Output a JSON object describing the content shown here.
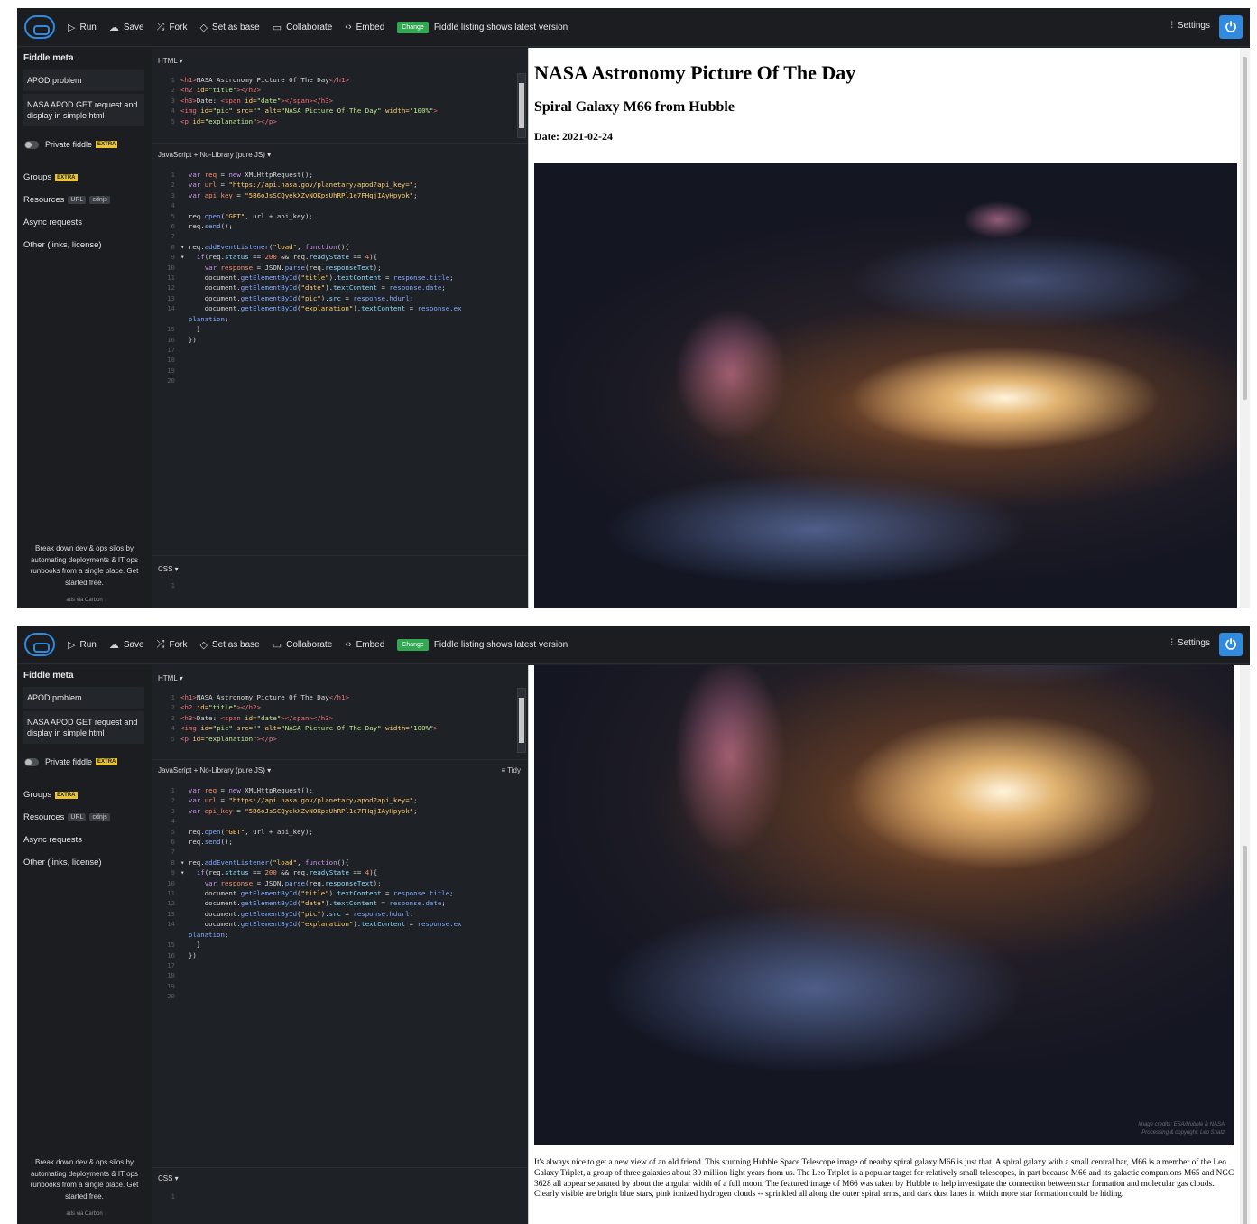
{
  "toolbar": {
    "run": "Run",
    "save": "Save",
    "fork": "Fork",
    "set_as_base": "Set as base",
    "collaborate": "Collaborate",
    "embed": "Embed",
    "change_badge": "Change",
    "listing_text": "Fiddle listing shows latest version",
    "settings": "Settings",
    "accent_color": "#2f8ae0",
    "badge_color": "#33a852"
  },
  "sidebar": {
    "title": "Fiddle meta",
    "fiddle_title": "APOD problem",
    "fiddle_description": "NASA APOD GET request and display in simple html",
    "private_label": "Private fiddle",
    "extra_badge": "EXTRA",
    "groups": "Groups",
    "resources": "Resources",
    "url_tag": "URL",
    "cdnjs_tag": "cdnjs",
    "async": "Async requests",
    "other": "Other (links, license)",
    "ad_text": "Break down dev & ops silos by automating deployments & IT ops runbooks from a single place. Get started free.",
    "ads_via": "ads via Carbon"
  },
  "editor": {
    "html_label": "HTML ▾",
    "js_label": "JavaScript + No-Library (pure JS) ▾",
    "css_label": "CSS ▾",
    "tidy": "≡ Tidy"
  },
  "result": {
    "h1": "NASA Astronomy Picture Of The Day",
    "h2": "Spiral Galaxy M66 from Hubble",
    "h3": "Date: 2021-02-24",
    "image_credit_line1": "Image credits: ESA/Hubble & NASA",
    "image_credit_line2": "Processing & copyright: Leo Shatz",
    "explanation": "It's always nice to get a new view of an old friend. This stunning Hubble Space Telescope image of nearby spiral galaxy M66 is just that. A spiral galaxy with a small central bar, M66 is a member of the Leo Galaxy Triplet, a group of three galaxies about 30 million light years from us. The Leo Triplet is a popular target for relatively small telescopes, in part because M66 and its galactic companions M65 and NGC 3628 all appear separated by about the angular width of a full moon. The featured image of M66 was taken by Hubble to help investigate the connection between star formation and molecular gas clouds. Clearly visible are bright blue stars, pink ionized hydrogen clouds -- sprinkled all along the outer spiral arms, and dark dust lanes in which more star formation could be hiding."
  }
}
